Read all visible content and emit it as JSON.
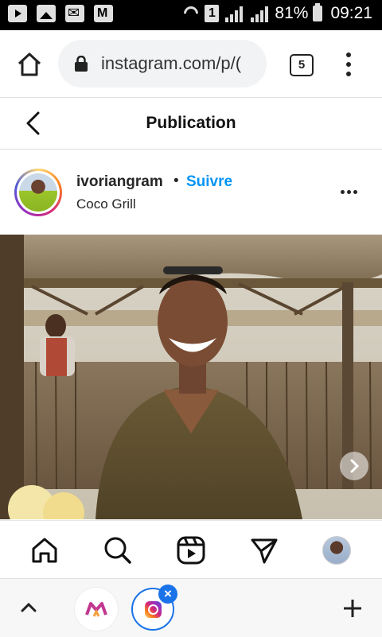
{
  "status_bar": {
    "battery": "81%",
    "time": "09:21",
    "sim": "1",
    "icons": [
      "youtube-icon",
      "gallery-icon",
      "mail-icon",
      "gmail-icon",
      "wifi-icon",
      "signal-icon",
      "battery-icon"
    ]
  },
  "browser": {
    "url": "instagram.com/p/(",
    "tab_count": "5"
  },
  "header": {
    "title": "Publication"
  },
  "post": {
    "username": "ivoriangram",
    "separator": "•",
    "follow_label": "Suivre",
    "location": "Coco Grill"
  },
  "bottom_tabs": {
    "colors": {
      "instagram_gradient": [
        "#feda75",
        "#fa7e1e",
        "#d62976",
        "#962fbf",
        "#4f5bd5"
      ],
      "active_ring": "#1a73e8"
    }
  },
  "colors": {
    "follow": "#0095f6",
    "text": "#262626"
  }
}
